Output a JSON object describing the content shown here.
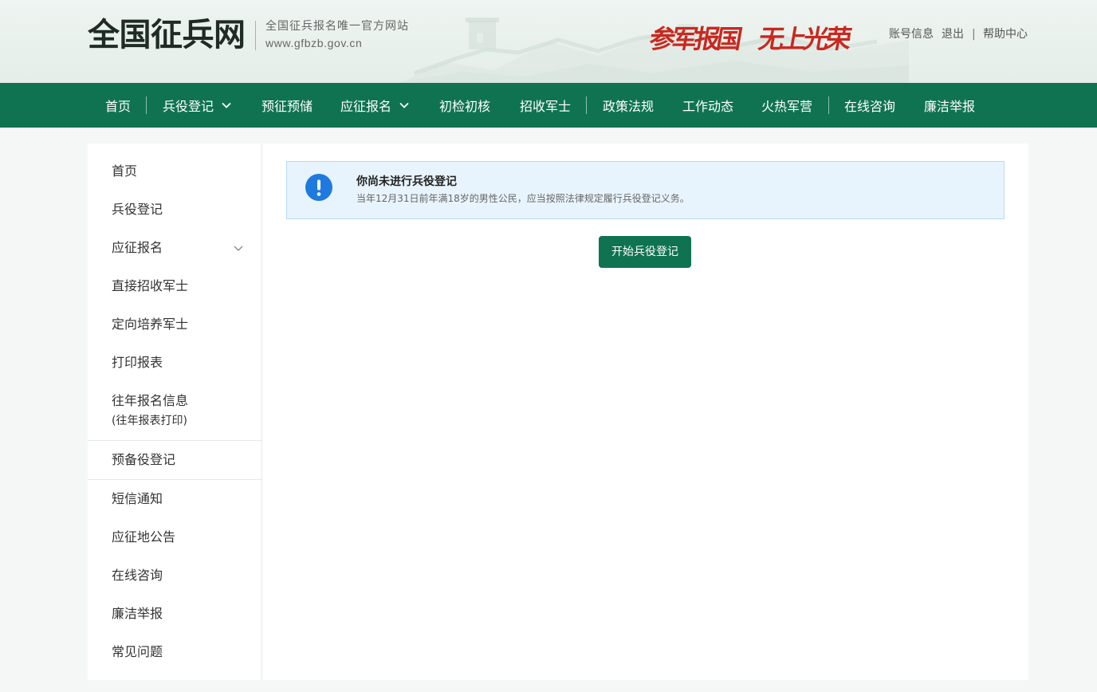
{
  "colors": {
    "brand_green": "#0f7352",
    "slogan_red": "#c9281f",
    "alert_blue": "#1f7ae0",
    "page_bg": "#f5f7f6"
  },
  "header": {
    "logo_text": "全国征兵网",
    "subtitle": "全国征兵报名唯一官方网站",
    "site_url": "www.gfbzb.gov.cn",
    "slogan_left": "参军报国",
    "slogan_right": "无上光荣",
    "links": {
      "account": "账号信息",
      "logout": "退出",
      "separator": "|",
      "help": "帮助中心"
    }
  },
  "nav": {
    "items": [
      {
        "label": "首页"
      },
      {
        "label": "兵役登记",
        "icon": "chevron-down-icon"
      },
      {
        "label": "预征预储"
      },
      {
        "label": "应征报名",
        "icon": "chevron-down-icon"
      },
      {
        "label": "初检初核"
      },
      {
        "label": "招收军士"
      },
      {
        "label": "政策法规"
      },
      {
        "label": "工作动态"
      },
      {
        "label": "火热军营"
      },
      {
        "label": "在线咨询"
      },
      {
        "label": "廉洁举报"
      }
    ]
  },
  "sidebar": {
    "items": [
      {
        "label": "首页"
      },
      {
        "label": "兵役登记"
      },
      {
        "label": "应征报名",
        "icon": "chevron-down-icon"
      },
      {
        "label": "直接招收军士"
      },
      {
        "label": "定向培养军士"
      },
      {
        "label": "打印报表"
      },
      {
        "label": "往年报名信息",
        "sublabel": "(往年报表打印)"
      },
      {
        "label": "预备役登记"
      },
      {
        "label": "短信通知"
      },
      {
        "label": "应征地公告"
      },
      {
        "label": "在线咨询"
      },
      {
        "label": "廉洁举报"
      },
      {
        "label": "常见问题"
      }
    ]
  },
  "main": {
    "alert": {
      "icon": "exclamation-circle-icon",
      "title": "你尚未进行兵役登记",
      "description": "当年12月31日前年满18岁的男性公民，应当按照法律规定履行兵役登记义务。"
    },
    "start_button": "开始兵役登记"
  }
}
